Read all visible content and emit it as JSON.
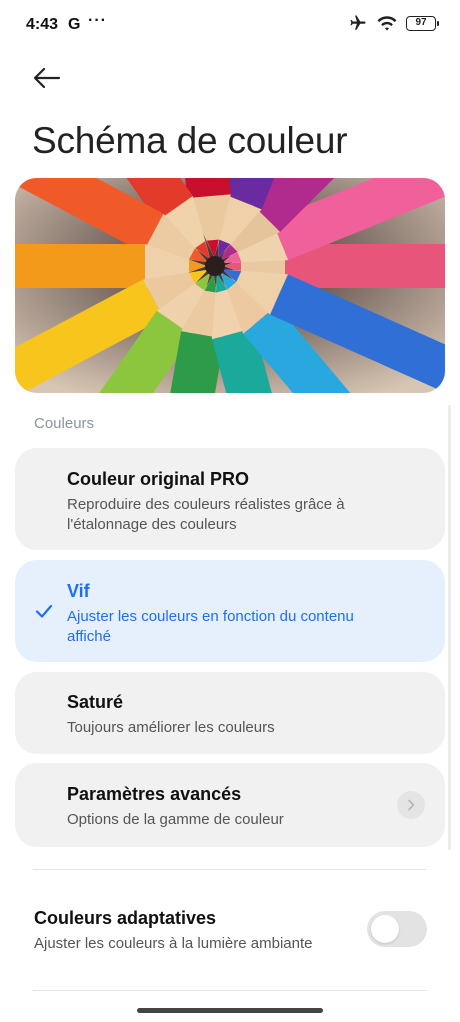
{
  "status_bar": {
    "time": "4:43",
    "g_label": "G",
    "dots": "···",
    "battery": "97"
  },
  "header": {
    "title": "Schéma de couleur"
  },
  "section": {
    "label": "Couleurs"
  },
  "options": [
    {
      "title": "Couleur original PRO",
      "description": "Reproduire des couleurs réalistes grâce à l'étalonnage des couleurs",
      "selected": false
    },
    {
      "title": "Vif",
      "description": "Ajuster les couleurs en fonction du contenu affiché",
      "selected": true
    },
    {
      "title": "Saturé",
      "description": "Toujours améliorer les couleurs",
      "selected": false
    },
    {
      "title": "Paramètres avancés",
      "description": "Options de la gamme de couleur",
      "selected": false
    }
  ],
  "adaptive": {
    "title": "Couleurs adaptatives",
    "description": "Ajuster les couleurs à la lumière ambiante",
    "enabled": false
  },
  "colors": {
    "accent": "#1f6ef2",
    "card_bg": "#f1f1f1",
    "selected_bg": "#e6f0fd"
  }
}
